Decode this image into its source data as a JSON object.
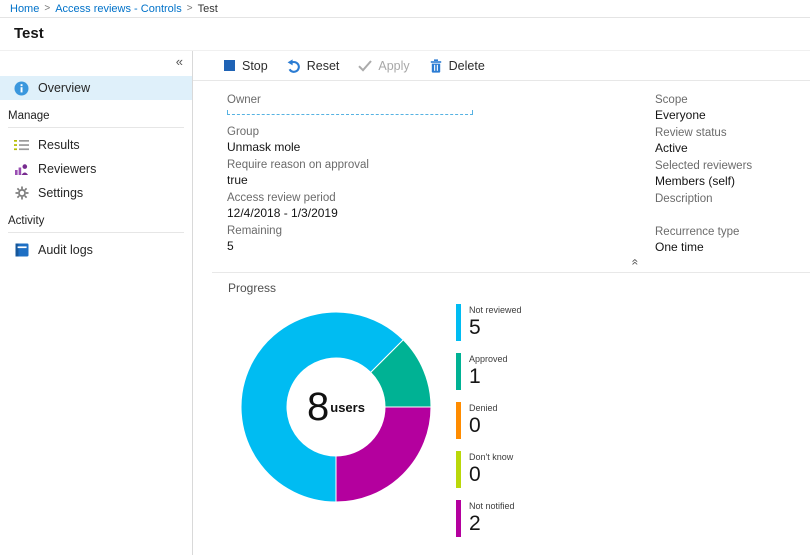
{
  "breadcrumb": {
    "separator": ">",
    "items": [
      {
        "label": "Home",
        "link": true
      },
      {
        "label": "Access reviews - Controls",
        "link": true
      },
      {
        "label": "Test",
        "link": false
      }
    ]
  },
  "page_title": "Test",
  "sidebar": {
    "collapse_icon": "«",
    "overview": {
      "label": "Overview"
    },
    "sections": [
      {
        "header": "Manage",
        "items": [
          {
            "label": "Results"
          },
          {
            "label": "Reviewers"
          },
          {
            "label": "Settings"
          }
        ]
      },
      {
        "header": "Activity",
        "items": [
          {
            "label": "Audit logs"
          }
        ]
      }
    ]
  },
  "toolbar": {
    "buttons": [
      {
        "label": "Stop",
        "disabled": false
      },
      {
        "label": "Reset",
        "disabled": false
      },
      {
        "label": "Apply",
        "disabled": true
      },
      {
        "label": "Delete",
        "disabled": false
      }
    ]
  },
  "essentials": {
    "collapse_icon": "«",
    "left": [
      {
        "label": "Owner",
        "value": ""
      },
      {
        "label": "Group",
        "value": "Unmask mole"
      },
      {
        "label": "Require reason on approval",
        "value": "true"
      },
      {
        "label": "Access review period",
        "value": "12/4/2018 - 1/3/2019"
      },
      {
        "label": "Remaining",
        "value": "5"
      }
    ],
    "right": [
      {
        "label": "Scope",
        "value": "Everyone"
      },
      {
        "label": "Review status",
        "value": "Active"
      },
      {
        "label": "Selected reviewers",
        "value": "Members (self)"
      },
      {
        "label": "Description",
        "value": ""
      },
      {
        "label": "Recurrence type",
        "value": "One time"
      }
    ]
  },
  "progress_title": "Progress",
  "chart_data": {
    "type": "pie",
    "subtype": "donut",
    "title": "Progress",
    "start_angle": 45,
    "center": {
      "value": "8",
      "unit": "users"
    },
    "total": 8,
    "segments": [
      {
        "label": "Not reviewed",
        "value": 5,
        "color": "#00bcf2"
      },
      {
        "label": "Approved",
        "value": 1,
        "color": "#00b294"
      },
      {
        "label": "Denied",
        "value": 0,
        "color": "#ff8c00"
      },
      {
        "label": "Don't know",
        "value": 0,
        "color": "#bad80a"
      },
      {
        "label": "Not notified",
        "value": 2,
        "color": "#b4009e"
      }
    ],
    "legend_position": "right"
  }
}
